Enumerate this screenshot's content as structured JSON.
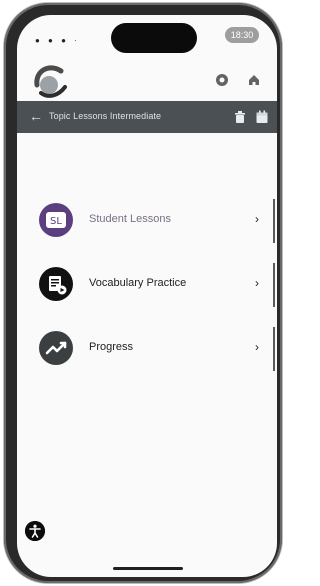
{
  "status_bar": {
    "time": "18:30"
  },
  "header": {
    "back_icon": "back-arrow-icon",
    "title": "Topic Lessons Intermediate"
  },
  "menu": [
    {
      "label": "Student Lessons",
      "icon": "student-lessons-icon",
      "icon_text": "SL",
      "icon_bg": "#5b3f7f",
      "label_color": "#7a6e86"
    },
    {
      "label": "Vocabulary Practice",
      "icon": "vocabulary-practice-icon",
      "icon_bg": "#111111",
      "label_color": "#1f1f1f"
    },
    {
      "label": "Progress",
      "icon": "progress-chart-icon",
      "icon_bg": "#3b3f41",
      "label_color": "#1f1f1f"
    }
  ],
  "colors": {
    "header_bg": "#4a5054",
    "screen_bg": "#fafafa"
  }
}
